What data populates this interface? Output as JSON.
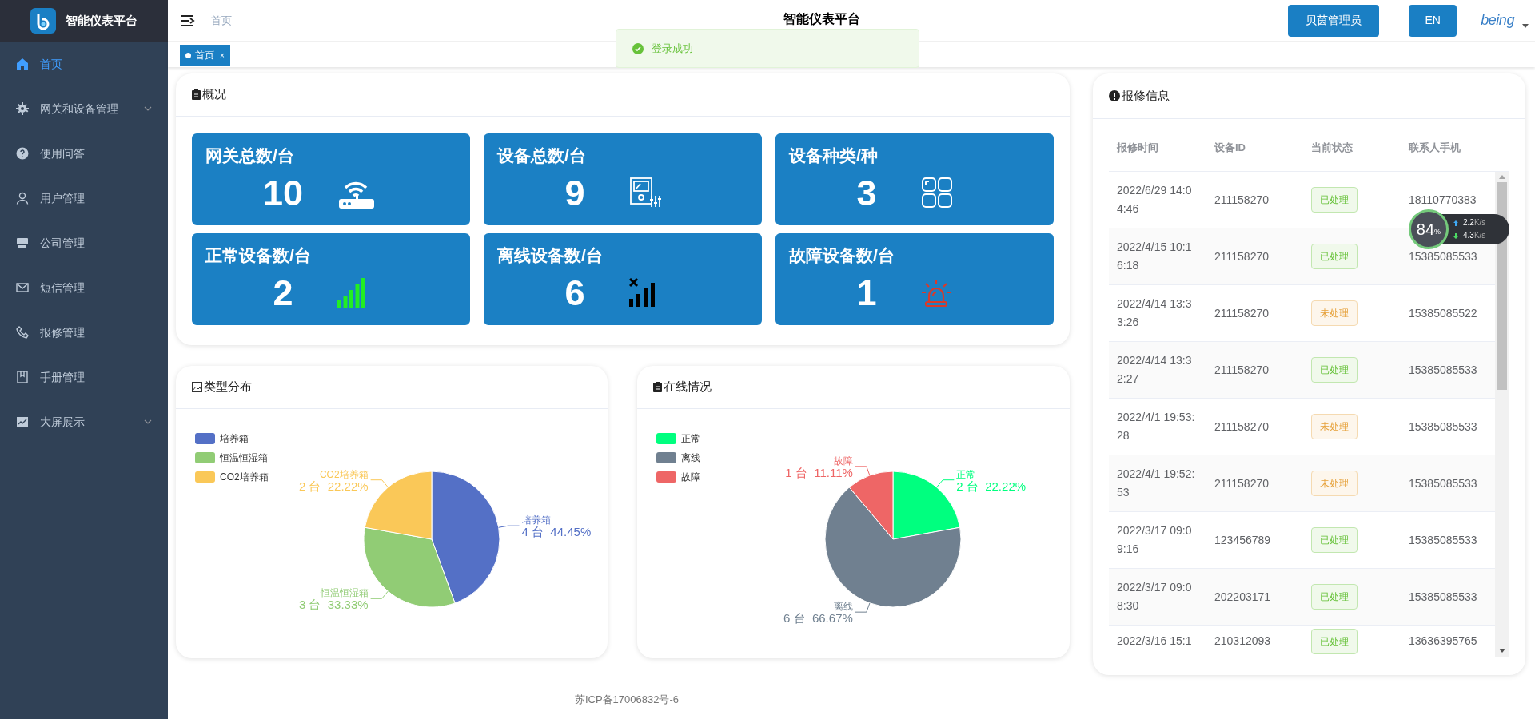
{
  "brand": {
    "title": "智能仪表平台"
  },
  "sidebar": {
    "items": [
      {
        "label": "首页",
        "selected": true,
        "expandable": false
      },
      {
        "label": "网关和设备管理",
        "selected": false,
        "expandable": true
      },
      {
        "label": "使用问答",
        "selected": false,
        "expandable": false
      },
      {
        "label": "用户管理",
        "selected": false,
        "expandable": false
      },
      {
        "label": "公司管理",
        "selected": false,
        "expandable": false
      },
      {
        "label": "短信管理",
        "selected": false,
        "expandable": false
      },
      {
        "label": "报修管理",
        "selected": false,
        "expandable": false
      },
      {
        "label": "手册管理",
        "selected": false,
        "expandable": false
      },
      {
        "label": "大屏展示",
        "selected": false,
        "expandable": true
      }
    ]
  },
  "header": {
    "breadcrumb": "首页",
    "title": "智能仪表平台",
    "user_button": "贝茵管理员",
    "language_button": "EN",
    "logo_text": "being"
  },
  "tabs": [
    {
      "label": "首页",
      "selected": true,
      "close": "×"
    }
  ],
  "toast": {
    "message": "登录成功"
  },
  "overview": {
    "title": "概况",
    "tiles": [
      {
        "label": "网关总数/台",
        "value": "10"
      },
      {
        "label": "设备总数/台",
        "value": "9"
      },
      {
        "label": "设备种类/种",
        "value": "3"
      },
      {
        "label": "正常设备数/台",
        "value": "2"
      },
      {
        "label": "离线设备数/台",
        "value": "6"
      },
      {
        "label": "故障设备数/台",
        "value": "1"
      }
    ]
  },
  "type_distribution": {
    "title": "类型分布",
    "legend": [
      {
        "label": "培养箱",
        "color": "#5470c6"
      },
      {
        "label": "恒温恒湿箱",
        "color": "#91cc75"
      },
      {
        "label": "CO2培养箱",
        "color": "#fac858"
      }
    ],
    "chart_data": {
      "type": "pie",
      "categories": [
        "培养箱",
        "恒温恒湿箱",
        "CO2培养箱"
      ],
      "values": [
        44.45,
        33.33,
        22.22
      ],
      "value_labels": [
        "4 台  44.45%",
        "3 台  33.33%",
        "2 台  22.22%"
      ]
    }
  },
  "online_status": {
    "title": "在线情况",
    "legend": [
      {
        "label": "正常",
        "color": "#00ff7f"
      },
      {
        "label": "离线",
        "color": "#708090"
      },
      {
        "label": "故障",
        "color": "#ee6666"
      }
    ],
    "chart_data": {
      "type": "pie",
      "categories": [
        "正常",
        "离线",
        "故障"
      ],
      "values": [
        22.22,
        66.67,
        11.11
      ],
      "value_labels": [
        "2 台  22.22%",
        "6 台  66.67%",
        "1 台  11.11%"
      ]
    }
  },
  "repairs": {
    "title": "报修信息",
    "columns": [
      "报修时间",
      "设备ID",
      "当前状态",
      "联系人手机"
    ],
    "rows": [
      {
        "time": "2022/6/29 14:04:46",
        "device_id": "211158270",
        "status": {
          "text": "已处理",
          "kind": "done"
        },
        "phone": "18110770383"
      },
      {
        "time": "2022/4/15 10:16:18",
        "device_id": "211158270",
        "status": {
          "text": "已处理",
          "kind": "done"
        },
        "phone": "15385085533"
      },
      {
        "time": "2022/4/14 13:33:26",
        "device_id": "211158270",
        "status": {
          "text": "未处理",
          "kind": "pending"
        },
        "phone": "15385085522"
      },
      {
        "time": "2022/4/14 13:32:27",
        "device_id": "211158270",
        "status": {
          "text": "已处理",
          "kind": "done"
        },
        "phone": "15385085533"
      },
      {
        "time": "2022/4/1 19:53:28",
        "device_id": "211158270",
        "status": {
          "text": "未处理",
          "kind": "pending"
        },
        "phone": "15385085533"
      },
      {
        "time": "2022/4/1 19:52:53",
        "device_id": "211158270",
        "status": {
          "text": "未处理",
          "kind": "pending"
        },
        "phone": "15385085533"
      },
      {
        "time": "2022/3/17 09:09:16",
        "device_id": "123456789",
        "status": {
          "text": "已处理",
          "kind": "done"
        },
        "phone": "15385085533"
      },
      {
        "time": "2022/3/17 09:08:30",
        "device_id": "202203171",
        "status": {
          "text": "已处理",
          "kind": "done"
        },
        "phone": "15385085533"
      },
      {
        "time": "2022/3/16 15:1",
        "device_id": "210312093",
        "status": {
          "text": "已处理",
          "kind": "done"
        },
        "phone": "13636395765"
      }
    ]
  },
  "net_monitor": {
    "percent": "84",
    "percent_unit": "%",
    "upload": "2.2",
    "upload_unit": "K/s",
    "download": "4.3",
    "download_unit": "K/s"
  },
  "footer": "苏ICP备17006832号-6"
}
